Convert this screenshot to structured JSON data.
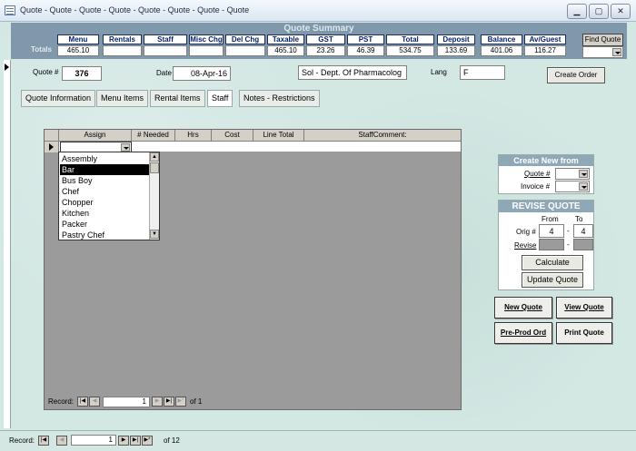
{
  "window": {
    "title": "Quote - Quote - Quote - Quote - Quote - Quote - Quote - Quote"
  },
  "summary": {
    "title": "Quote Summary",
    "row_label": "Totals",
    "columns": [
      {
        "header": "Menu",
        "value": "465.10"
      },
      {
        "header": "Rentals",
        "value": ""
      },
      {
        "header": "Staff",
        "value": ""
      },
      {
        "header": "Misc Chg",
        "value": ""
      },
      {
        "header": "Del Chg",
        "value": ""
      },
      {
        "header": "Taxable",
        "value": "465.10"
      },
      {
        "header": "GST",
        "value": "23.26"
      },
      {
        "header": "PST",
        "value": "46.39"
      },
      {
        "header": "Total",
        "value": "534.75"
      },
      {
        "header": "Deposit",
        "value": "133.69"
      },
      {
        "header": "Balance",
        "value": "401.06"
      },
      {
        "header": "Av/Guest",
        "value": "116.27"
      }
    ],
    "find_quote_label": "Find Quote",
    "find_quote_value": ""
  },
  "quote_info": {
    "quote_label": "Quote #",
    "quote_value": "376",
    "date_label": "Date",
    "date_value": "08-Apr-16",
    "client_value": "Sol - Dept. Of Pharmacolog",
    "lang_label": "Lang",
    "lang_value": "F",
    "create_order_label": "Create Order"
  },
  "tabs": [
    {
      "label": "Quote Information"
    },
    {
      "label": "Menu Items"
    },
    {
      "label": "Rental Items"
    },
    {
      "label": "Staff"
    },
    {
      "label": "Notes - Restrictions"
    }
  ],
  "staff_grid": {
    "columns": [
      "Assign",
      "# Needed",
      "Hrs",
      "Cost",
      "Line Total",
      "StaffComment:"
    ],
    "assign_options": [
      "Assembly",
      "Bar",
      "Bus Boy",
      "Chef",
      "Chopper",
      "Kitchen",
      "Packer",
      "Pastry Chef"
    ],
    "selected_option": "Bar",
    "record_label": "Record:",
    "record_current": "1",
    "record_of": "of 1"
  },
  "create_new": {
    "title": "Create New from",
    "quote_label": "Quote #",
    "invoice_label": "Invoice #"
  },
  "revise": {
    "title": "REVISE QUOTE",
    "from_label": "From",
    "to_label": "To",
    "orig_label": "Orig #",
    "orig_from": "4",
    "orig_to": "4",
    "sep": "-",
    "revise_label": "Revise",
    "calculate_label": "Calculate",
    "update_label": "Update Quote"
  },
  "actions": {
    "new_quote": "New Quote",
    "view_quote": "View Quote",
    "pre_prod": "Pre-Prod Ord",
    "print_quote": "Print Quote"
  },
  "main_record": {
    "record_label": "Record:",
    "current": "1",
    "of": "of 12"
  }
}
